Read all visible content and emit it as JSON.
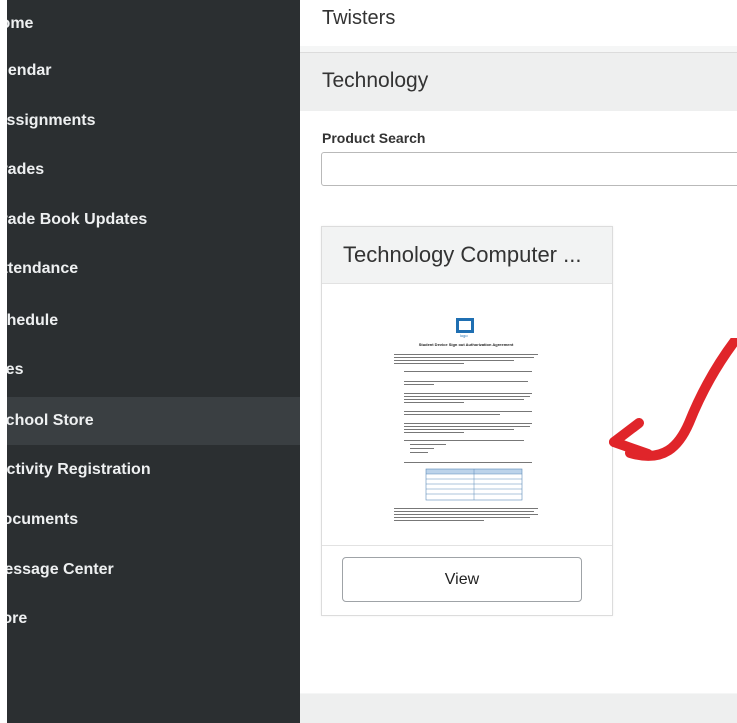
{
  "sidebar": {
    "items": [
      {
        "label": "Home"
      },
      {
        "label": "Calendar"
      },
      {
        "label": "Assignments"
      },
      {
        "label": "Grades"
      },
      {
        "label": "Grade Book Updates"
      },
      {
        "label": "Attendance"
      },
      {
        "label": "Schedule"
      },
      {
        "label": "Fees"
      },
      {
        "label": "School Store"
      },
      {
        "label": "Activity Registration"
      },
      {
        "label": "Documents"
      },
      {
        "label": "Message Center"
      },
      {
        "label": "More"
      }
    ]
  },
  "main": {
    "top_title": "Twisters",
    "section_title": "Technology",
    "search": {
      "label": "Product Search",
      "value": "",
      "placeholder": ""
    },
    "product": {
      "title": "Technology Computer ...",
      "view_label": "View",
      "document": {
        "heading": "Student Device Sign out Authorization Agreement",
        "logo": "logo"
      }
    }
  },
  "annotation": {
    "color": "#e0252a",
    "icon": "curved-arrow-icon"
  }
}
